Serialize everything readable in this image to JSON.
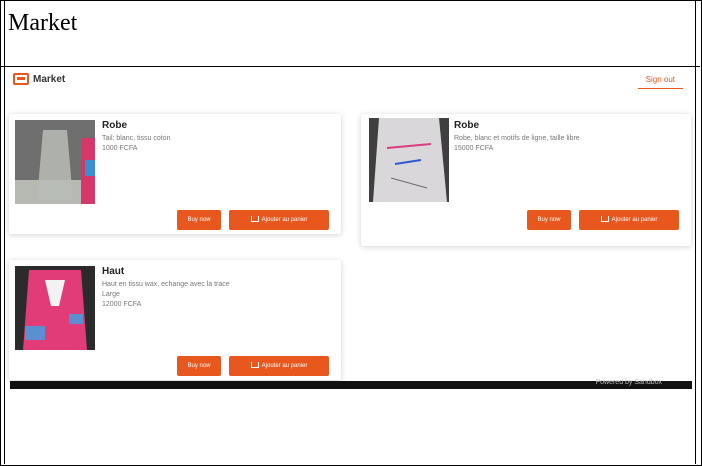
{
  "document": {
    "title": "Market"
  },
  "app": {
    "brand": "Market",
    "signout_label": "Sign out",
    "footer_text": "Powered by Sandbox"
  },
  "products": [
    {
      "title": "Robe",
      "desc_lines": [
        "Tail: blanc, tissu coton",
        "1000 FCFA"
      ],
      "buy_label": "Buy now",
      "cart_label": "Ajouter au panier",
      "image_colors": [
        "#6f6f6f",
        "#b7b9b3",
        "#d6376b",
        "#3b8fd0"
      ]
    },
    {
      "title": "Robe",
      "desc_lines": [
        "Robe, blanc et motifs de ligne, taille libre",
        "15000 FCFA"
      ],
      "buy_label": "Buy now",
      "cart_label": "Ajouter au panier",
      "image_colors": [
        "#3f3f3f",
        "#d9d7da",
        "#d93d82",
        "#2f5bd2"
      ]
    },
    {
      "title": "Haut",
      "desc_lines": [
        "Haut en tissu wax, echange avec la trace",
        "Large",
        "12000 FCFA"
      ],
      "buy_label": "Buy now",
      "cart_label": "Ajouter au panier",
      "image_colors": [
        "#2b2b2b",
        "#e13c78",
        "#5b8fd0",
        "#f2f2f2"
      ]
    }
  ]
}
